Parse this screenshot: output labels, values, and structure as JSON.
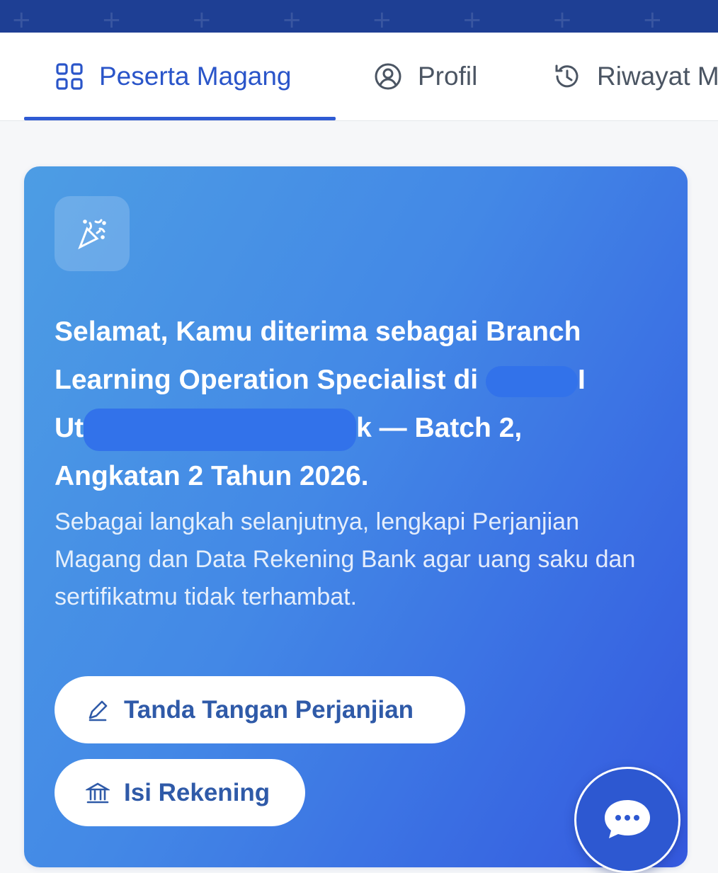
{
  "tabs": [
    {
      "label": "Peserta Magang",
      "icon": "grid-icon",
      "active": true
    },
    {
      "label": "Profil",
      "icon": "user-circle-icon",
      "active": false
    },
    {
      "label": "Riwayat M",
      "icon": "history-icon",
      "active": false
    }
  ],
  "card": {
    "badge_icon": "party-popper-icon",
    "headline": {
      "line1": "Selamat, Kamu diterima sebagai Branch",
      "line2_start": "Learning Operation Specialist di ",
      "line2_end": "I",
      "line3_start": "Ut",
      "line3_end": "k — Batch 2,",
      "line4": "Angkatan 2 Tahun 2026."
    },
    "body": "Sebagai langkah selanjutnya, lengkapi Perjanjian Magang dan Data Rekening Bank agar uang saku dan sertifikatmu tidak terhambat.",
    "buttons": {
      "sign_label": "Tanda Tangan Perjanjian",
      "sign_icon": "pencil-icon",
      "bank_label": "Isi Rekening",
      "bank_icon": "bank-icon"
    }
  },
  "chat_fab_icon": "chat-bubble-icon",
  "colors": {
    "primary": "#2f5bd3",
    "banner": "#1e3f94",
    "card_start": "#4d9de4",
    "card_end": "#3559de",
    "button_text": "#2f5aa8"
  }
}
